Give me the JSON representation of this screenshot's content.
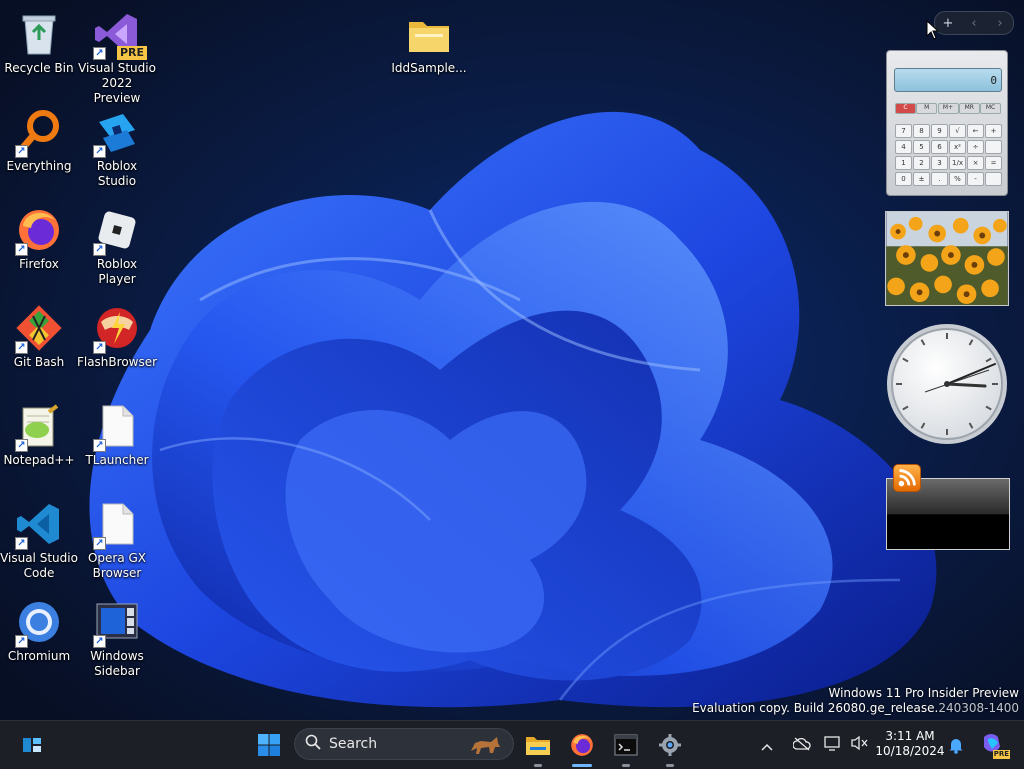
{
  "desktop": {
    "icons": [
      {
        "label": "Recycle Bin",
        "icon": "recycle-bin-icon"
      },
      {
        "label": "Visual Studio\n2022 Preview",
        "icon": "visual-studio-preview-icon",
        "badge": "PRE"
      },
      {
        "label": "IddSample...",
        "icon": "folder-icon"
      },
      {
        "label": "Everything",
        "icon": "everything-search-icon"
      },
      {
        "label": "Roblox Studio",
        "icon": "roblox-studio-icon"
      },
      {
        "label": "Firefox",
        "icon": "firefox-icon"
      },
      {
        "label": "Roblox Player",
        "icon": "roblox-player-icon"
      },
      {
        "label": "Git Bash",
        "icon": "git-bash-icon"
      },
      {
        "label": "FlashBrowser",
        "icon": "flashbrowser-icon"
      },
      {
        "label": "Notepad++",
        "icon": "notepad-plus-plus-icon"
      },
      {
        "label": "TLauncher",
        "icon": "blank-file-icon"
      },
      {
        "label": "Visual Studio\nCode",
        "icon": "vscode-icon"
      },
      {
        "label": "Opera GX\nBrowser",
        "icon": "blank-file-icon"
      },
      {
        "label": "Chromium",
        "icon": "chromium-icon"
      },
      {
        "label": "Windows\nSidebar",
        "icon": "windows-sidebar-icon"
      }
    ]
  },
  "gadgets": {
    "toolbar": {
      "add": "+",
      "prev": "‹",
      "next": "›"
    },
    "calculator": {
      "display": "0",
      "memory": [
        "C",
        "M",
        "M+",
        "MR",
        "MC"
      ],
      "keys": [
        "7",
        "8",
        "9",
        "√",
        "←",
        "+",
        "4",
        "5",
        "6",
        "x²",
        "÷",
        "",
        "1",
        "2",
        "3",
        "1/x",
        "×",
        "=",
        "0",
        "±",
        ".",
        "%",
        "-",
        ""
      ]
    }
  },
  "watermark": {
    "line1": "Windows 11 Pro Insider Preview",
    "line2": "Evaluation copy. Build 26080.ge_release.",
    "line2_dim": "240308-1400"
  },
  "taskbar": {
    "search_placeholder": "Search",
    "time": "3:11 AM",
    "date": "10/18/2024",
    "copilot_badge": "PRE"
  }
}
